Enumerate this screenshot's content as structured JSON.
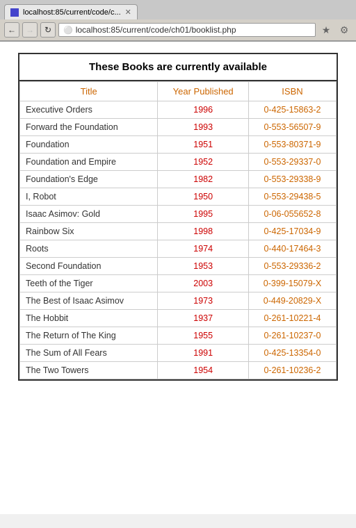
{
  "browser": {
    "tab_title": "localhost:85/current/code/c...",
    "address": "localhost:85/current/code/ch01/booklist.php",
    "back_disabled": false,
    "forward_disabled": true
  },
  "page": {
    "heading": "These Books are currently available",
    "table": {
      "columns": [
        "Title",
        "Year Published",
        "ISBN"
      ],
      "rows": [
        {
          "title": "Executive Orders",
          "year": "1996",
          "isbn": "0-425-15863-2"
        },
        {
          "title": "Forward the Foundation",
          "year": "1993",
          "isbn": "0-553-56507-9"
        },
        {
          "title": "Foundation",
          "year": "1951",
          "isbn": "0-553-80371-9"
        },
        {
          "title": "Foundation and Empire",
          "year": "1952",
          "isbn": "0-553-29337-0"
        },
        {
          "title": "Foundation's Edge",
          "year": "1982",
          "isbn": "0-553-29338-9"
        },
        {
          "title": "I, Robot",
          "year": "1950",
          "isbn": "0-553-29438-5"
        },
        {
          "title": "Isaac Asimov: Gold",
          "year": "1995",
          "isbn": "0-06-055652-8"
        },
        {
          "title": "Rainbow Six",
          "year": "1998",
          "isbn": "0-425-17034-9"
        },
        {
          "title": "Roots",
          "year": "1974",
          "isbn": "0-440-17464-3"
        },
        {
          "title": "Second Foundation",
          "year": "1953",
          "isbn": "0-553-29336-2"
        },
        {
          "title": "Teeth of the Tiger",
          "year": "2003",
          "isbn": "0-399-15079-X"
        },
        {
          "title": "The Best of Isaac Asimov",
          "year": "1973",
          "isbn": "0-449-20829-X"
        },
        {
          "title": "The Hobbit",
          "year": "1937",
          "isbn": "0-261-10221-4"
        },
        {
          "title": "The Return of The King",
          "year": "1955",
          "isbn": "0-261-10237-0"
        },
        {
          "title": "The Sum of All Fears",
          "year": "1991",
          "isbn": "0-425-13354-0"
        },
        {
          "title": "The Two Towers",
          "year": "1954",
          "isbn": "0-261-10236-2"
        }
      ]
    }
  }
}
